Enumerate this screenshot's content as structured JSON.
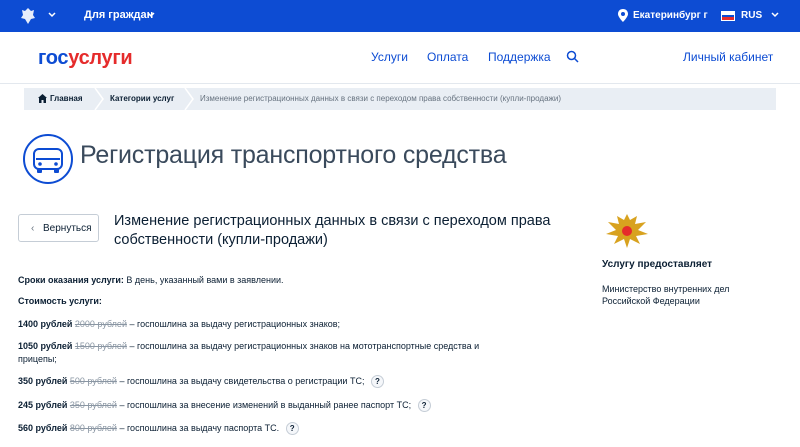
{
  "topbar": {
    "audience": "Для граждан",
    "city": "Екатеринбург г",
    "language": "RUS",
    "colors": {
      "background": "#0d4cd3"
    }
  },
  "header": {
    "logo_part1": "гос",
    "logo_part2": "услуги",
    "nav": [
      "Услуги",
      "Оплата",
      "Поддержка"
    ],
    "cabinet": "Личный кабинет"
  },
  "breadcrumb": {
    "home": "Главная",
    "category": "Категории услуг",
    "current": "Изменение регистрационных данных в связи с переходом права собственности (купли-продажи)"
  },
  "page": {
    "title": "Регистрация транспортного средства",
    "title_icon": "car-icon"
  },
  "service": {
    "back_label": "Вернуться",
    "title": "Изменение регистрационных данных в связи с переходом права собственности (купли-продажи)",
    "terms_label": "Сроки оказания услуги:",
    "terms_value": "В день, указанный вами в заявлении.",
    "cost_label": "Стоимость услуги:",
    "prices": [
      {
        "price": "1400 рублей",
        "old": "2000 рублей",
        "text": "– госпошлина за выдачу регистрационных знаков;",
        "help": false
      },
      {
        "price": "1050 рублей",
        "old": "1500 рублей",
        "text": "– госпошлина за выдачу регистрационных знаков на мототранспортные средства и прицепы;",
        "help": false
      },
      {
        "price": "350 рублей",
        "old": "500 рублей",
        "text": "– госпошлина за выдачу свидетельства о регистрации ТС;",
        "help": true
      },
      {
        "price": "245 рублей",
        "old": "350 рублей",
        "text": "– госпошлина за внесение изменений в выданный ранее паспорт ТС;",
        "help": true
      },
      {
        "price": "560 рублей",
        "old": "800 рублей",
        "text": "– госпошлина за выдачу паспорта ТС.",
        "help": true
      }
    ]
  },
  "provider": {
    "heading": "Услугу предоставляет",
    "name": "Министерство внутренних дел Российской Федерации"
  }
}
